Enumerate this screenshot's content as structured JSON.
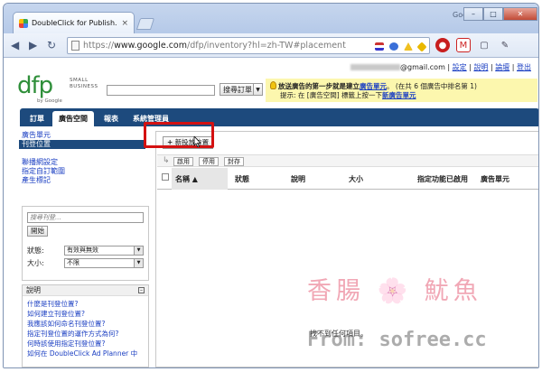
{
  "browser": {
    "tab_title": "DoubleClick for Publish...",
    "tab_close": "×",
    "brand": "Google",
    "min": "–",
    "max": "□",
    "close": "✕",
    "back": "◀",
    "forward": "▶",
    "reload": "↻",
    "url_prefix": "https://",
    "url_main": "www.google.com",
    "url_path": "/dfp/inventory?hl=zh-TW#placement"
  },
  "header": {
    "user_suffix": "@gmail.com",
    "links": [
      "設定",
      "說明",
      "論壇",
      "登出"
    ],
    "logo_text": "dfp",
    "logo_small_1": "SMALL",
    "logo_small_2": "BUSINESS",
    "logo_by": "by Google",
    "order_button": "搜尋訂單",
    "order_drop": "▼"
  },
  "notice": {
    "line1_prefix": "放送廣告的第一步就是建立",
    "line1_link": "廣告單元",
    "line1_suffix": "。 (在共 6 個廣告中排名第 1)",
    "line2_prefix": "提示: 在 [廣告空間] 標籤上按一下",
    "line2_link": "新廣告單元"
  },
  "nav": {
    "tabs": [
      "訂單",
      "廣告空間",
      "報表",
      "系統管理員"
    ]
  },
  "sidebar": {
    "items_top": [
      "廣告單元",
      "刊登位置"
    ],
    "items_mid": [
      "聯播網設定",
      "指定自訂範圍",
      "產生標記"
    ],
    "search_placeholder": "搜尋刊登...",
    "start_button": "開始",
    "status_label": "狀態:",
    "status_value": "有效與無效",
    "size_label": "大小:",
    "size_value": "不限"
  },
  "help": {
    "title": "說明",
    "toggle": "⊟",
    "links": [
      "什麼是刊登位置?",
      "如何建立刊登位置?",
      "我應該如何命名刊登位置?",
      "指定刊登位置的運作方式為何?",
      "何時該使用指定刊登位置?",
      "如何在 DoubleClick Ad Planner 中"
    ]
  },
  "main": {
    "add_button": "新投放位置",
    "actions": [
      "啟用",
      "停用",
      "封存"
    ],
    "columns": [
      "名稱 ▲",
      "狀態",
      "說明",
      "大小",
      "指定功能已啟用",
      "廣告單元"
    ],
    "empty_message": "找不到任何項目。"
  },
  "watermark": {
    "chinese": "香腸 🌸 魷魚",
    "url": "From: sofree.cc"
  }
}
